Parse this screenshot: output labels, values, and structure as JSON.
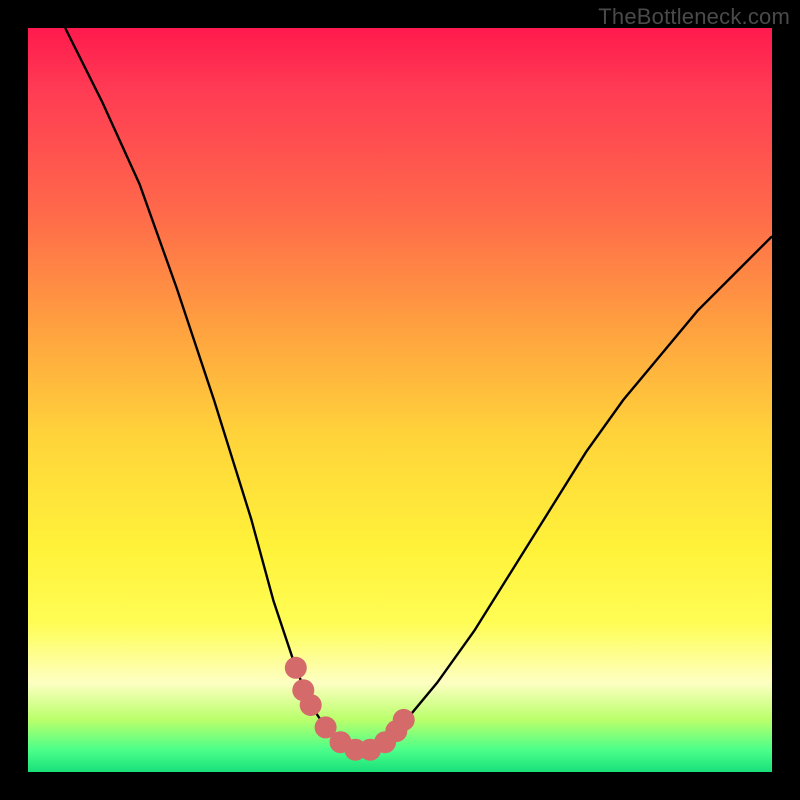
{
  "watermark": "TheBottleneck.com",
  "chart_data": {
    "type": "line",
    "title": "",
    "xlabel": "",
    "ylabel": "",
    "xlim": [
      0,
      100
    ],
    "ylim": [
      0,
      100
    ],
    "series": [
      {
        "name": "bottleneck-curve",
        "x": [
          5,
          10,
          15,
          20,
          25,
          30,
          33,
          36,
          38,
          40,
          42,
          44,
          46,
          48,
          50,
          55,
          60,
          65,
          70,
          75,
          80,
          85,
          90,
          95,
          100
        ],
        "y": [
          100,
          90,
          79,
          65,
          50,
          34,
          23,
          14,
          9,
          6,
          4,
          3,
          3,
          4,
          6,
          12,
          19,
          27,
          35,
          43,
          50,
          56,
          62,
          67,
          72
        ]
      }
    ],
    "markers": {
      "name": "highlighted-points",
      "color": "#d46a6a",
      "points": [
        {
          "x": 36,
          "y": 14
        },
        {
          "x": 37,
          "y": 11
        },
        {
          "x": 38,
          "y": 9
        },
        {
          "x": 40,
          "y": 6
        },
        {
          "x": 42,
          "y": 4
        },
        {
          "x": 44,
          "y": 3
        },
        {
          "x": 46,
          "y": 3
        },
        {
          "x": 48,
          "y": 4
        },
        {
          "x": 49.5,
          "y": 5.5
        },
        {
          "x": 50.5,
          "y": 7
        }
      ]
    },
    "gradient_stops": [
      {
        "pct": 0,
        "color": "#ff1a4d"
      },
      {
        "pct": 25,
        "color": "#ff6a4a"
      },
      {
        "pct": 55,
        "color": "#ffd43a"
      },
      {
        "pct": 80,
        "color": "#fffd55"
      },
      {
        "pct": 97,
        "color": "#4cff8a"
      },
      {
        "pct": 100,
        "color": "#18e07a"
      }
    ]
  }
}
